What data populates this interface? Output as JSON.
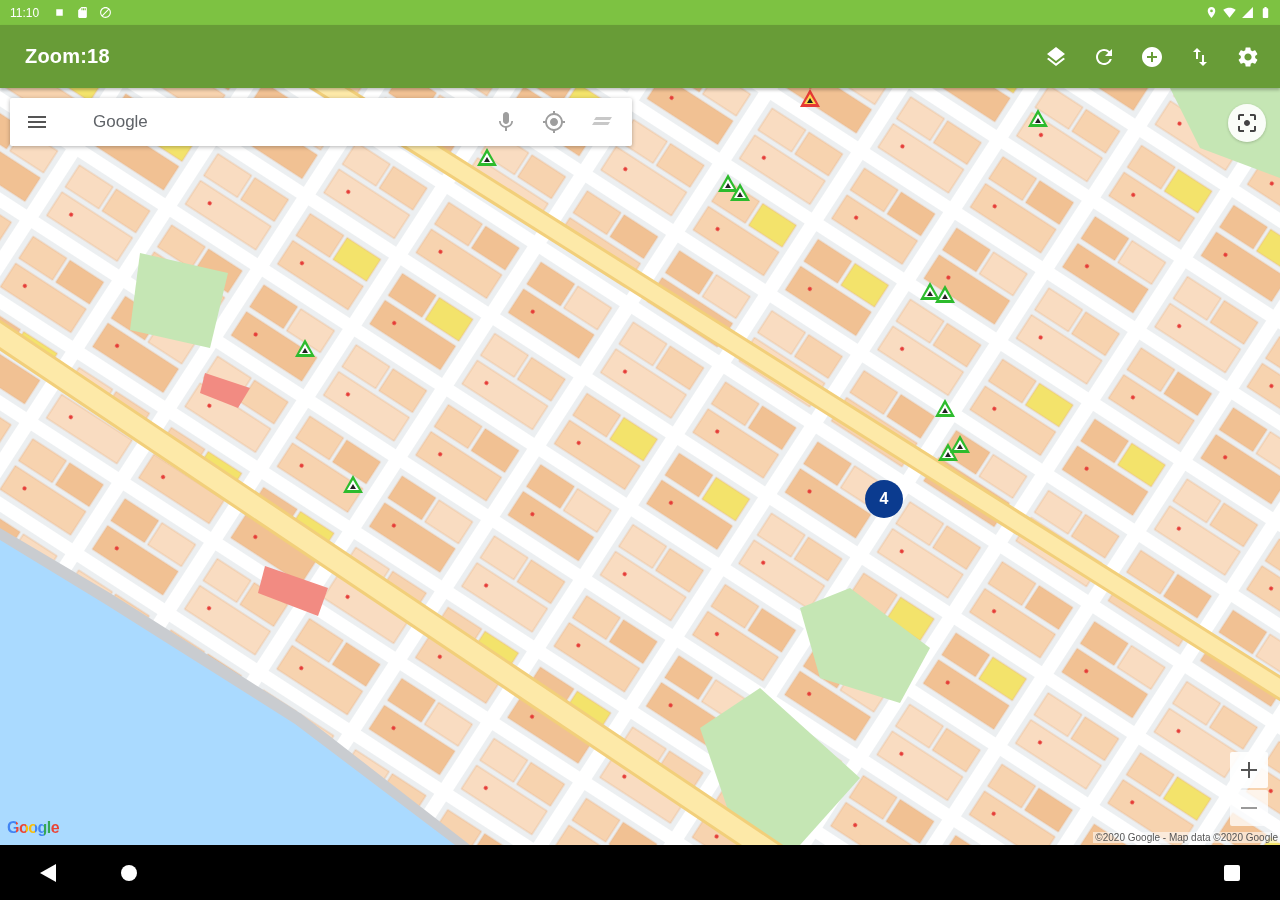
{
  "status_bar": {
    "time": "11:10"
  },
  "app_bar": {
    "title": "Zoom:18"
  },
  "search": {
    "placeholder": "Google"
  },
  "map": {
    "cluster_markers": [
      {
        "count": "4"
      }
    ],
    "logo": "Google",
    "attribution": "©2020 Google - Map data ©2020 Google"
  }
}
